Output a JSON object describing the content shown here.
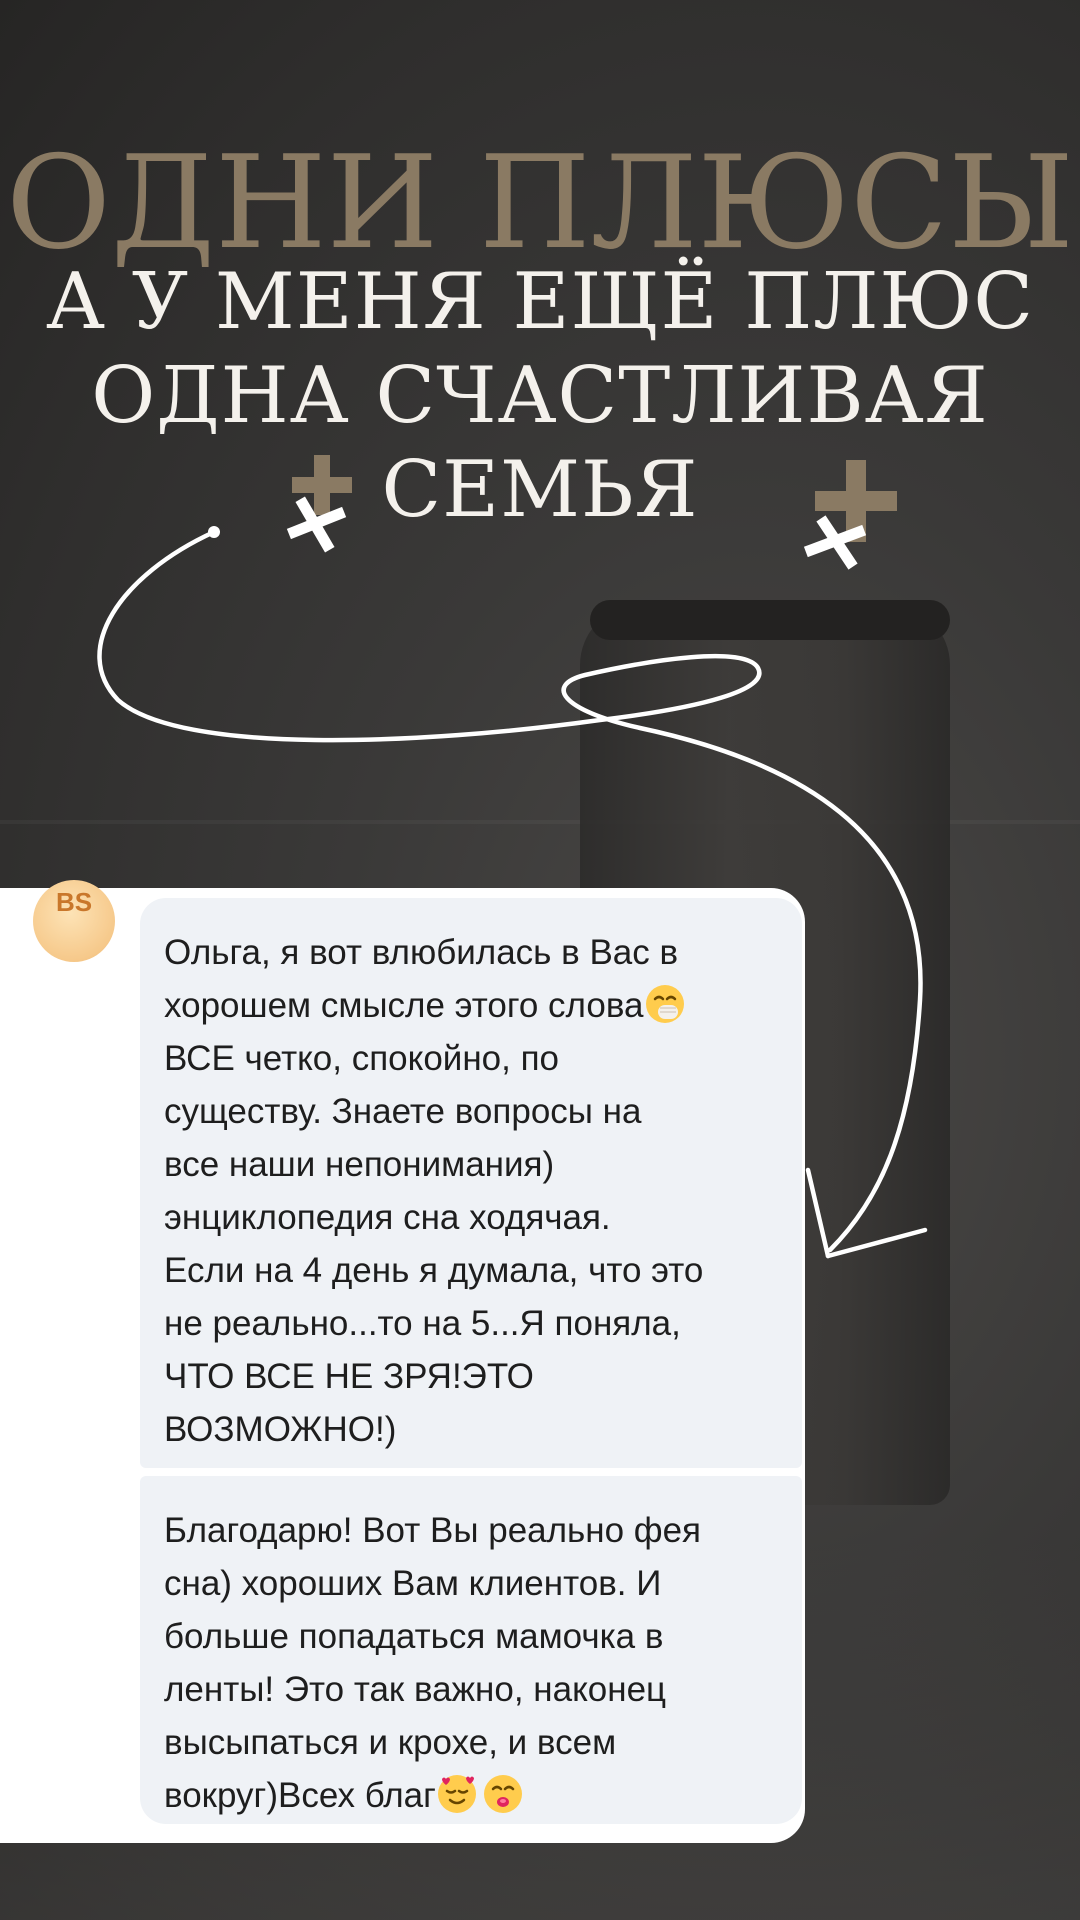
{
  "background_word": "ОДНИ ПЛЮСЫ",
  "headline": {
    "line1": "А У МЕНЯ ЕЩЁ ПЛЮС",
    "line2": "ОДНА СЧАСТЛИВАЯ",
    "line3": "СЕМЬЯ"
  },
  "avatar": {
    "initials": "BS"
  },
  "message1": {
    "lines": [
      "Ольга, я вот влюбилась в Вас в",
      "хорошем смысле этого слова",
      "ВСЕ четко, спокойно, по",
      "существу. Знаете вопросы на",
      "все наши непонимания)",
      "энциклопедия сна ходячая.",
      "Если на 4 день я думала, что это",
      "не реально...то на 5...Я поняла,",
      "ЧТО ВСЕ НЕ ЗРЯ!ЭТО",
      "ВОЗМОЖНО!)"
    ]
  },
  "message2": {
    "lines": [
      "Благодарю! Вот Вы реально фея",
      "сна) хороших Вам клиентов. И",
      "больше попадаться мамочка в",
      "ленты! Это так важно, наконец",
      "высыпаться и крохе, и всем",
      "вокруг)Всех благ"
    ]
  },
  "colors": {
    "background": "#333231",
    "background_word": "#8a7a63",
    "headline": "#f4f1ec",
    "bubble": "#eff2f6",
    "plus_tan": "#8a7a63",
    "avatar_text": "#c9772b"
  },
  "icons": [
    "hand-over-mouth-emoji-icon",
    "smiling-face-with-hearts-emoji-icon",
    "kissing-face-emoji-icon",
    "plus-icon",
    "cross-icon",
    "curved-arrow-icon"
  ]
}
